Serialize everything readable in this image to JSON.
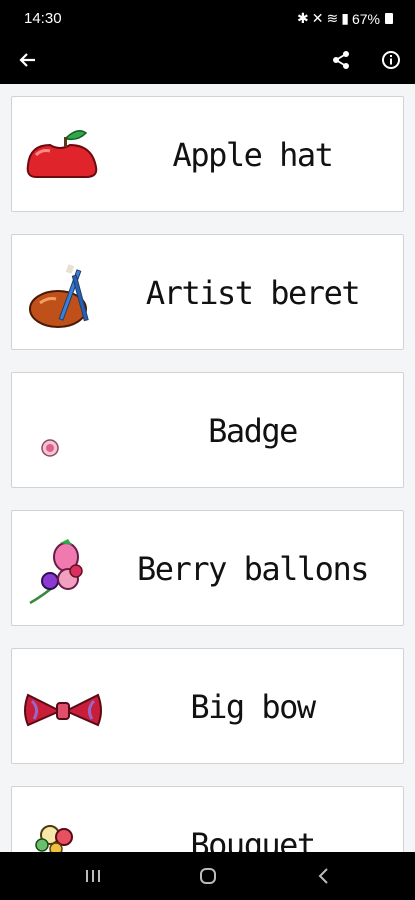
{
  "status": {
    "time": "14:30",
    "battery": "67%"
  },
  "app_bar": {
    "back_icon": "arrow-left-icon",
    "share_icon": "share-icon",
    "info_icon": "info-icon"
  },
  "items": [
    {
      "label": "Apple hat",
      "icon": "apple-hat-icon"
    },
    {
      "label": "Artist beret",
      "icon": "artist-beret-icon"
    },
    {
      "label": "Badge",
      "icon": "badge-icon"
    },
    {
      "label": "Berry ballons",
      "icon": "berry-balloons-icon"
    },
    {
      "label": "Big bow",
      "icon": "big-bow-icon"
    },
    {
      "label": "Bouquet",
      "icon": "bouquet-icon"
    }
  ],
  "nav": {
    "recents_icon": "recents-icon",
    "home_icon": "home-icon",
    "back_icon": "back-chevron-icon"
  }
}
